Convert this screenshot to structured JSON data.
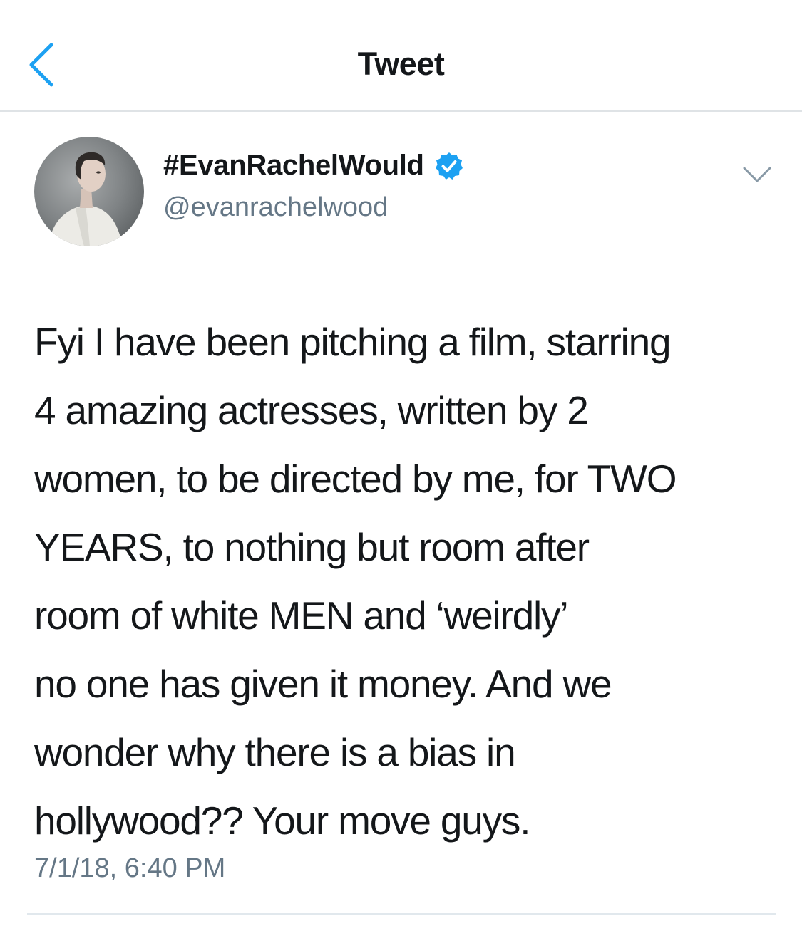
{
  "nav": {
    "title": "Tweet",
    "back_icon": "chevron-left-icon",
    "accent_color": "#1da1f2"
  },
  "author": {
    "display_name": "#EvanRachelWould",
    "handle": "@evanrachelwood",
    "verified_icon": "verified-badge-icon",
    "menu_icon": "chevron-down-icon"
  },
  "tweet": {
    "lines": [
      "Fyi I have been pitching a film, starring",
      "4 amazing actresses, written by 2",
      "women, to be directed by me, for TWO",
      "YEARS, to nothing but room after",
      "room of white MEN and ‘weirdly’",
      "no one has given it money. And we",
      "wonder why there is a bias in",
      "hollywood?? Your move guys."
    ],
    "timestamp": "7/1/18, 6:40 PM"
  },
  "colors": {
    "text": "#14171a",
    "secondary": "#657786",
    "divider": "#e1e8ed"
  }
}
